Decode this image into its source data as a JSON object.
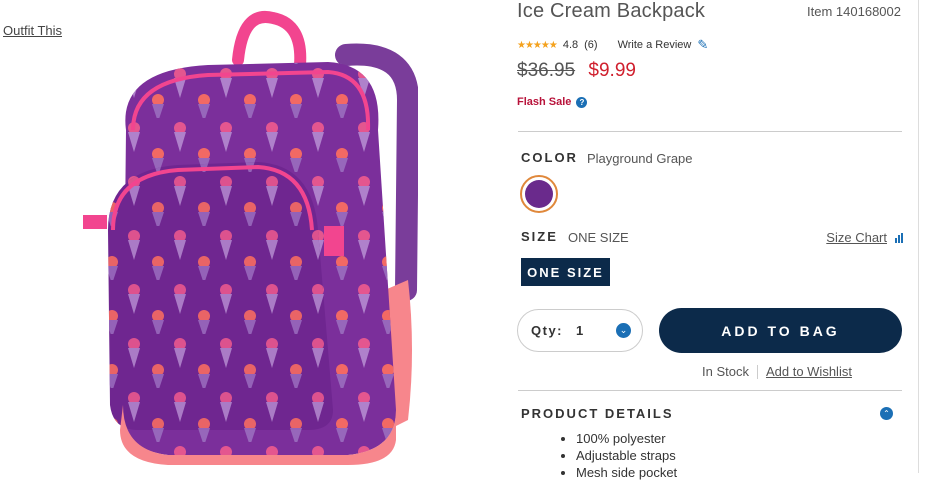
{
  "page": {
    "outfit_link": "Outfit This"
  },
  "product": {
    "title": "Ice Cream Backpack",
    "item_number": "Item 140168002",
    "rating": {
      "stars": "★★★★★",
      "value": "4.8",
      "count": "(6)",
      "write_review": "Write a Review"
    },
    "price": {
      "original": "$36.95",
      "sale": "$9.99"
    },
    "flash_sale": "Flash Sale",
    "color": {
      "label": "COLOR",
      "selected": "Playground Grape",
      "swatch_hex": "#6a2a8c"
    },
    "size": {
      "label": "SIZE",
      "selected": "ONE SIZE",
      "chart_link": "Size Chart",
      "button": "ONE SIZE"
    },
    "qty": {
      "label": "Qty:",
      "value": "1"
    },
    "add_to_bag": "ADD TO BAG",
    "stock": {
      "status": "In Stock",
      "wishlist": "Add to Wishlist"
    },
    "details": {
      "title": "PRODUCT DETAILS",
      "items": [
        "100% polyester",
        "Adjustable straps",
        "Mesh side pocket"
      ]
    }
  },
  "colors": {
    "accent": "#1b6fb5",
    "navy": "#0c2a4a",
    "sale_red": "#d0202e",
    "flash": "#b8123a"
  }
}
